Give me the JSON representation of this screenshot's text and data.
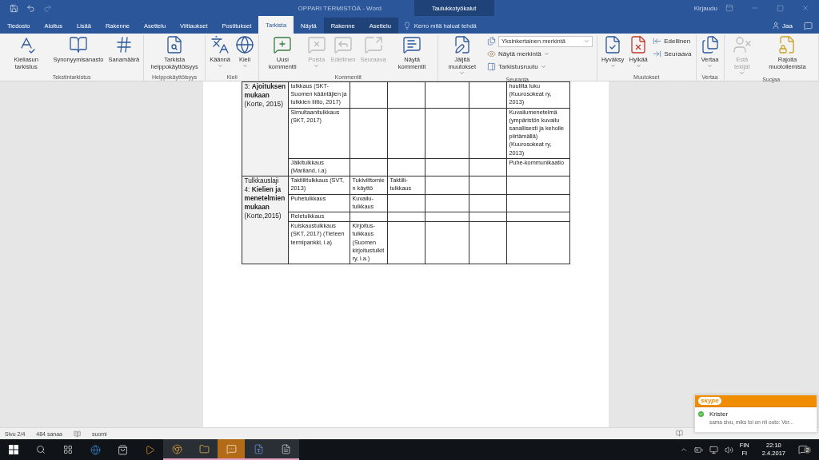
{
  "window": {
    "title": "OPPARI TERMISTÖÄ  -  Word",
    "context_label": "Taulukkotyökalut",
    "sign_in": "Kirjaudu"
  },
  "tabs": [
    {
      "label": "Tiedosto",
      "selected": false
    },
    {
      "label": "Aloitus",
      "selected": false
    },
    {
      "label": "Lisää",
      "selected": false
    },
    {
      "label": "Rakenne",
      "selected": false
    },
    {
      "label": "Asettelu",
      "selected": false
    },
    {
      "label": "Viittaukset",
      "selected": false
    },
    {
      "label": "Postitukset",
      "selected": false
    },
    {
      "label": "Tarkista",
      "selected": true
    },
    {
      "label": "Näytä",
      "selected": false
    },
    {
      "label": "Rakenne",
      "selected": false
    },
    {
      "label": "Asettelu",
      "selected": false
    }
  ],
  "tell_me": {
    "placeholder": "Kerro mitä haluat tehdä"
  },
  "share": "Jaa",
  "ribbon": [
    {
      "name": "Tekstintarkistus",
      "items": [
        {
          "kind": "large",
          "label": "Kieliasun tarkistus",
          "disabled": false,
          "dropdown": false
        },
        {
          "kind": "large",
          "label": "Synonyymisanasto",
          "disabled": false,
          "dropdown": false
        },
        {
          "kind": "large",
          "label": "Sanamäärä",
          "disabled": false,
          "dropdown": false
        }
      ]
    },
    {
      "name": "Helppokäyttöisyys",
      "items": [
        {
          "kind": "large",
          "label": "Tarkista helppokäyttöisyys",
          "disabled": false,
          "dropdown": false
        }
      ]
    },
    {
      "name": "Kieli",
      "items": [
        {
          "kind": "large",
          "label": "Käännä",
          "disabled": false,
          "dropdown": true
        },
        {
          "kind": "large",
          "label": "Kieli",
          "disabled": false,
          "dropdown": true
        }
      ]
    },
    {
      "name": "Kommentit",
      "items": [
        {
          "kind": "large",
          "label": "Uusi kommentti",
          "disabled": false,
          "dropdown": false
        },
        {
          "kind": "large",
          "label": "Poista",
          "disabled": true,
          "dropdown": true
        },
        {
          "kind": "large",
          "label": "Edellinen",
          "disabled": true,
          "dropdown": false
        },
        {
          "kind": "large",
          "label": "Seuraava",
          "disabled": true,
          "dropdown": false
        },
        {
          "kind": "large",
          "label": "Näytä kommentit",
          "disabled": false,
          "dropdown": false
        }
      ]
    },
    {
      "name": "Seuranta",
      "items": [
        {
          "kind": "large",
          "label": "Jäljitä muutokset",
          "disabled": false,
          "dropdown": true
        },
        {
          "kind": "select",
          "label": "Yksinkertainen merkintä",
          "disabled": false,
          "dropdown": true
        },
        {
          "kind": "small",
          "label": "Näytä merkintä",
          "disabled": false,
          "dropdown": true
        },
        {
          "kind": "small",
          "label": "Tarkistusruutu",
          "disabled": false,
          "dropdown": true
        }
      ]
    },
    {
      "name": "Muutokset",
      "items": [
        {
          "kind": "large",
          "label": "Hyväksy",
          "disabled": false,
          "dropdown": true
        },
        {
          "kind": "large",
          "label": "Hylkää",
          "disabled": false,
          "dropdown": true
        },
        {
          "kind": "small",
          "label": "Edellinen",
          "disabled": false,
          "dropdown": false
        },
        {
          "kind": "small",
          "label": "Seuraava",
          "disabled": false,
          "dropdown": false
        }
      ]
    },
    {
      "name": "Vertaa",
      "items": [
        {
          "kind": "large",
          "label": "Vertaa",
          "disabled": false,
          "dropdown": true
        }
      ]
    },
    {
      "name": "Suojaa",
      "items": [
        {
          "kind": "large",
          "label": "Estä tekijät",
          "disabled": true,
          "dropdown": true
        },
        {
          "kind": "large",
          "label": "Rajoita muotoilemista",
          "disabled": false,
          "dropdown": false
        }
      ]
    }
  ],
  "table": {
    "groups": [
      {
        "heading": "3: **Ajoituksen mukaan** (Korte, 2015)",
        "rows": [
          {
            "cells": [
              "tulkkaus (SKT-Suomen kääntäjien ja tulkkien liitto, 2017)",
              "",
              "",
              "",
              "",
              "huulilta luku (Kuurosokeat ry, 2013)"
            ]
          },
          {
            "cells": [
              "Simultaanitulkkaus (SKT, 2017)",
              "",
              "",
              "",
              "",
              "Kuvailumenetelmä (ympäristön kuvailu sanallisesti ja keholle piirtämällä) (Kuurosokeat ry, 2013)"
            ]
          },
          {
            "cells": [
              "Jälkitulkkaus (Mariland, i.a)",
              "",
              "",
              "",
              "",
              "Puhe-kommunikaatio"
            ]
          }
        ]
      },
      {
        "heading": "Tulkkauslaji 4: **Kielien ja menetelmien mukaan** (Korte,2015)",
        "rows": [
          {
            "cells": [
              "Taktiilitulkkaus (SVT, 2013)",
              "Tukiviittomien käyttö",
              "Taktiili-tulkkaus",
              "",
              "",
              ""
            ]
          },
          {
            "cells": [
              "Puhetulkkaus",
              "Kuvailu-tulkkaus",
              "",
              "",
              "",
              ""
            ]
          },
          {
            "cells": [
              "Reletulkkaus",
              "",
              "",
              "",
              "",
              ""
            ]
          },
          {
            "cells": [
              "Kuiskaustulkkaus (SKT, 2017) (Tieteen termipankki, i.a)",
              "Kirjoitus-tulkkaus (Suomen kirjoitustulkit ry, i.a.)",
              "",
              "",
              "",
              ""
            ]
          }
        ]
      }
    ]
  },
  "status_bar": {
    "page": "Sivu 2/4",
    "words": "484 sanaa",
    "language": "suomi"
  },
  "notification": {
    "app": "skype",
    "sender": "Krister",
    "message": "sama sivu, miks toi on nii outo: Ver..."
  },
  "taskbar": {
    "input_language": "FIN",
    "keyboard": "FI",
    "time": "22:10",
    "date": "2.4.2017",
    "notifications": "2"
  }
}
